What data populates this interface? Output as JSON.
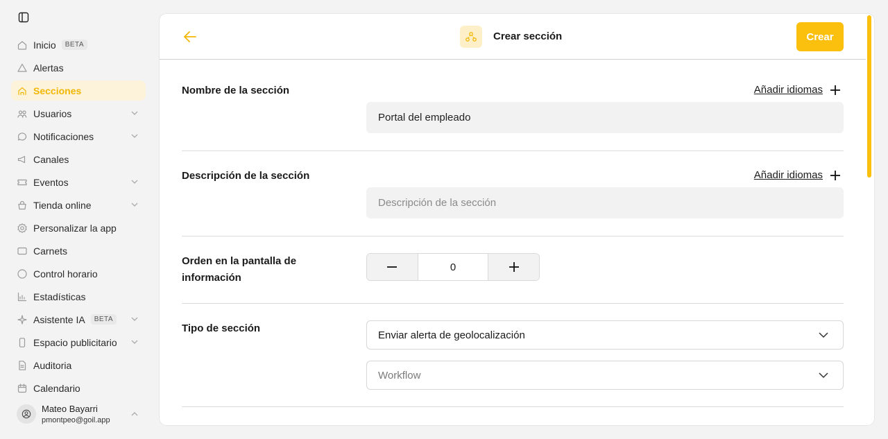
{
  "sidebar": {
    "items": [
      {
        "label": "Inicio",
        "badge": "BETA",
        "icon": "home-icon"
      },
      {
        "label": "Alertas",
        "icon": "alert-triangle-icon"
      },
      {
        "label": "Secciones",
        "icon": "sections-icon",
        "active": true
      },
      {
        "label": "Usuarios",
        "icon": "users-icon",
        "expandable": true
      },
      {
        "label": "Notificaciones",
        "icon": "chat-bubble-icon",
        "expandable": true
      },
      {
        "label": "Canales",
        "icon": "megaphone-icon"
      },
      {
        "label": "Eventos",
        "icon": "ticket-icon",
        "expandable": true
      },
      {
        "label": "Tienda online",
        "icon": "shop-icon",
        "expandable": true
      },
      {
        "label": "Personalizar la app",
        "icon": "settings-icon"
      },
      {
        "label": "Carnets",
        "icon": "card-icon"
      },
      {
        "label": "Control horario",
        "icon": "clock-icon"
      },
      {
        "label": "Estadísticas",
        "icon": "chart-icon"
      },
      {
        "label": "Asistente IA",
        "badge": "BETA",
        "icon": "sparkle-icon",
        "expandable": true
      },
      {
        "label": "Espacio publicitario",
        "icon": "phone-icon",
        "expandable": true
      },
      {
        "label": "Auditoria",
        "icon": "document-icon"
      },
      {
        "label": "Calendario",
        "icon": "calendar-icon"
      }
    ],
    "user": {
      "name": "Mateo Bayarri",
      "email": "pmontpeo@goil.app"
    }
  },
  "header": {
    "title": "Crear sección",
    "create_label": "Crear"
  },
  "form": {
    "name": {
      "label": "Nombre de la sección",
      "add_lang": "Añadir idiomas",
      "value": "Portal del empleado"
    },
    "description": {
      "label": "Descripción de la sección",
      "add_lang": "Añadir idiomas",
      "placeholder": "Descripción de la sección"
    },
    "order": {
      "label": "Orden en la pantalla de información",
      "value": "0"
    },
    "type": {
      "label": "Tipo de sección",
      "selected": "Enviar alerta de geolocalización",
      "workflow_placeholder": "Workflow"
    }
  },
  "colors": {
    "accent": "#fbbf0e",
    "active_bg": "#fdf3da"
  }
}
